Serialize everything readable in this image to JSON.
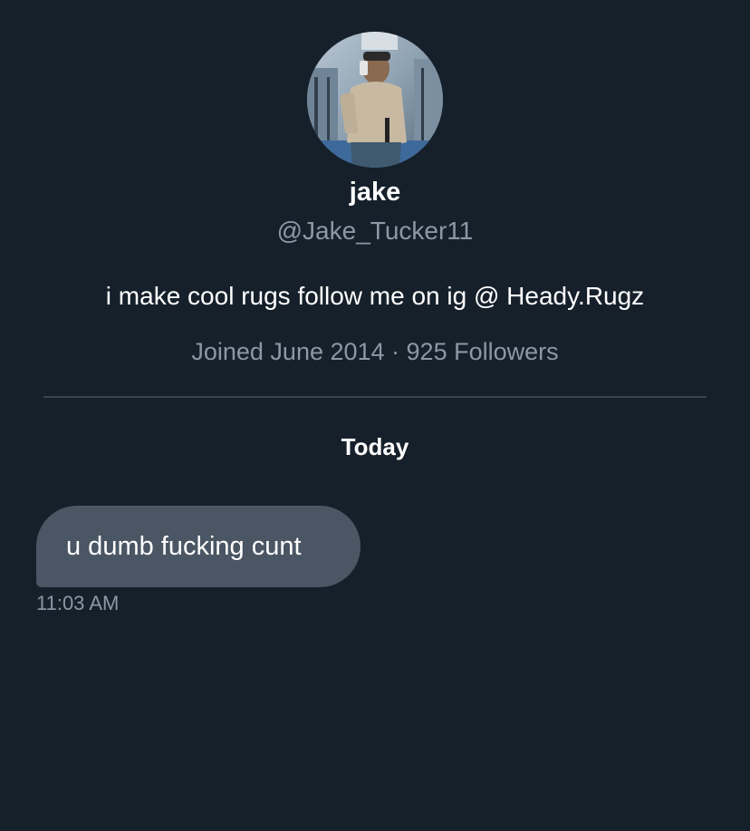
{
  "profile": {
    "name": "jake",
    "handle": "@Jake_Tucker11",
    "bio": "i make cool rugs follow me on ig @ Heady.Rugz",
    "meta": "Joined June 2014 · 925 Followers"
  },
  "conversation": {
    "day_label": "Today",
    "messages": [
      {
        "text": "u dumb fucking cunt",
        "time": "11:03 AM"
      }
    ]
  },
  "colors": {
    "background": "#16202b",
    "bubble": "#4a5663",
    "secondary_text": "#8b98a5",
    "divider": "#38444d"
  }
}
